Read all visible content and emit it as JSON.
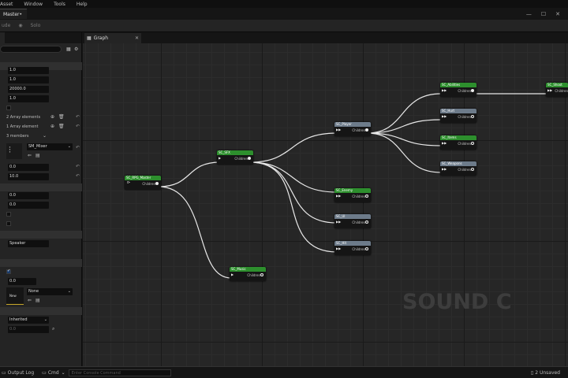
{
  "menu": [
    "Asset",
    "Window",
    "Tools",
    "Help"
  ],
  "doc_tab": "Master•",
  "toolbar": {
    "item1": "ude",
    "item2": "Solo"
  },
  "graph_tab": "Graph",
  "left_panel": {
    "fields": [
      {
        "value": "1.0"
      },
      {
        "value": "1.0"
      },
      {
        "value": "20000.0"
      },
      {
        "value": "1.0"
      }
    ],
    "array1": "2 Array elements",
    "array2": "1 Array element",
    "members": "3 members",
    "mixer": "SM_Mixer",
    "f_a": "0.0",
    "f_b": "10.0",
    "f_c": "0.0",
    "f_d": "0.0",
    "speaker": "Speaker",
    "f_e": "0.0",
    "none": "None",
    "new_label": "New",
    "inherited": "Inherited",
    "f_f": "0.0"
  },
  "nodes": {
    "master": {
      "title": "SC_RPG_Master",
      "pin": "Children"
    },
    "sfx": {
      "title": "SC_SFX",
      "pin": "Children"
    },
    "music": {
      "title": "SC_Music",
      "pin": "Children"
    },
    "player": {
      "title": "SC_Player",
      "pin": "Children"
    },
    "enemy": {
      "title": "SC_Enemy",
      "pin": "Children"
    },
    "ui": {
      "title": "SC_UI",
      "pin": "Children"
    },
    "hit": {
      "title": "SC_Hit",
      "pin": "Children"
    },
    "abilities": {
      "title": "SC_Abilities",
      "pin": "Children"
    },
    "hurt": {
      "title": "SC_Hurt",
      "pin": "Children"
    },
    "items": {
      "title": "SC_Items",
      "pin": "Children"
    },
    "weapons": {
      "title": "SC_Weapons",
      "pin": "Children"
    },
    "shoot": {
      "title": "SC_Shoot",
      "pin": "Children"
    }
  },
  "watermark": "SOUND C",
  "status": {
    "output_log": "Output Log",
    "cmd": "Cmd",
    "console_placeholder": "Enter Console Command",
    "unsaved": "2 Unsaved"
  }
}
